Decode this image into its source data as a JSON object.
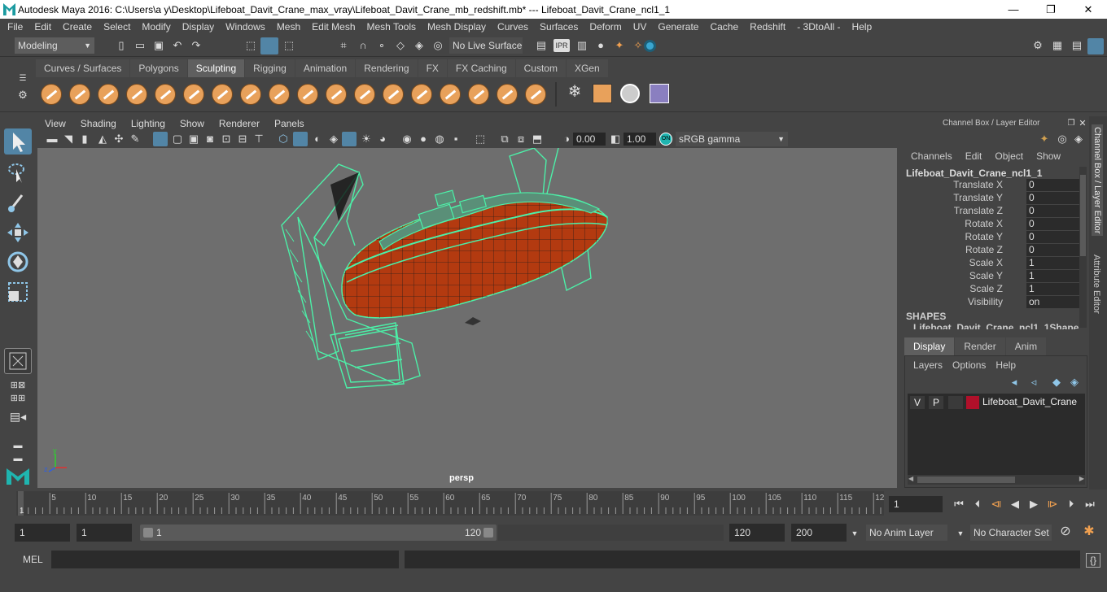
{
  "window": {
    "title": "Autodesk Maya 2016: C:\\Users\\a y\\Desktop\\Lifeboat_Davit_Crane_max_vray\\Lifeboat_Davit_Crane_mb_redshift.mb*   ---   Lifeboat_Davit_Crane_ncl1_1",
    "controls": [
      "—",
      "❐",
      "✕"
    ]
  },
  "menus": [
    "File",
    "Edit",
    "Create",
    "Select",
    "Modify",
    "Display",
    "Windows",
    "Mesh",
    "Edit Mesh",
    "Mesh Tools",
    "Mesh Display",
    "Curves",
    "Surfaces",
    "Deform",
    "UV",
    "Generate",
    "Cache",
    "Redshift",
    "- 3DtoAll -",
    "Help"
  ],
  "toolbar": {
    "mode": "Modeling",
    "live_surface": "No Live Surface"
  },
  "shelf_tabs": [
    {
      "label": "Curves / Surfaces",
      "active": false
    },
    {
      "label": "Polygons",
      "active": false
    },
    {
      "label": "Sculpting",
      "active": true
    },
    {
      "label": "Rigging",
      "active": false
    },
    {
      "label": "Animation",
      "active": false
    },
    {
      "label": "Rendering",
      "active": false
    },
    {
      "label": "FX",
      "active": false
    },
    {
      "label": "FX Caching",
      "active": false
    },
    {
      "label": "Custom",
      "active": false
    },
    {
      "label": "XGen",
      "active": false
    }
  ],
  "viewport": {
    "menus": [
      "View",
      "Shading",
      "Lighting",
      "Show",
      "Renderer",
      "Panels"
    ],
    "exposure": "0.00",
    "gamma": "1.00",
    "color_space": "sRGB gamma",
    "camera_label": "persp"
  },
  "channel_box": {
    "panel_title": "Channel Box / Layer Editor",
    "menus": [
      "Channels",
      "Edit",
      "Object",
      "Show"
    ],
    "object_name": "Lifeboat_Davit_Crane_ncl1_1",
    "channels": [
      {
        "name": "Translate X",
        "value": "0"
      },
      {
        "name": "Translate Y",
        "value": "0"
      },
      {
        "name": "Translate Z",
        "value": "0"
      },
      {
        "name": "Rotate X",
        "value": "0"
      },
      {
        "name": "Rotate Y",
        "value": "0"
      },
      {
        "name": "Rotate Z",
        "value": "0"
      },
      {
        "name": "Scale X",
        "value": "1"
      },
      {
        "name": "Scale Y",
        "value": "1"
      },
      {
        "name": "Scale Z",
        "value": "1"
      },
      {
        "name": "Visibility",
        "value": "on"
      }
    ],
    "shapes_header": "SHAPES",
    "shape_name": "Lifeboat_Davit_Crane_ncl1_1Shape"
  },
  "layer_editor": {
    "tabs": [
      {
        "label": "Display",
        "active": true
      },
      {
        "label": "Render",
        "active": false
      },
      {
        "label": "Anim",
        "active": false
      }
    ],
    "menus": [
      "Layers",
      "Options",
      "Help"
    ],
    "layer": {
      "v": "V",
      "p": "P",
      "name": "Lifeboat_Davit_Crane",
      "color": "#b0102a"
    }
  },
  "side_tabs": [
    "Channel Box / Layer Editor",
    "Attribute Editor"
  ],
  "timeline": {
    "ticks": [
      "5",
      "10",
      "15",
      "20",
      "25",
      "30",
      "35",
      "40",
      "45",
      "50",
      "55",
      "60",
      "65",
      "70",
      "75",
      "80",
      "85",
      "90",
      "95",
      "100",
      "105",
      "110",
      "115",
      "12"
    ],
    "start_marker": "1",
    "current_frame": "1"
  },
  "range": {
    "start": "1",
    "playback_start": "1",
    "slider_start": "1",
    "slider_end": "120",
    "playback_end": "120",
    "end": "200",
    "anim_layer": "No Anim Layer",
    "character_set": "No Character Set"
  },
  "command_line": {
    "label": "MEL"
  },
  "colors": {
    "wire": "#4cf0a8",
    "hull": "#b33a10",
    "accent": "#5285a6"
  }
}
